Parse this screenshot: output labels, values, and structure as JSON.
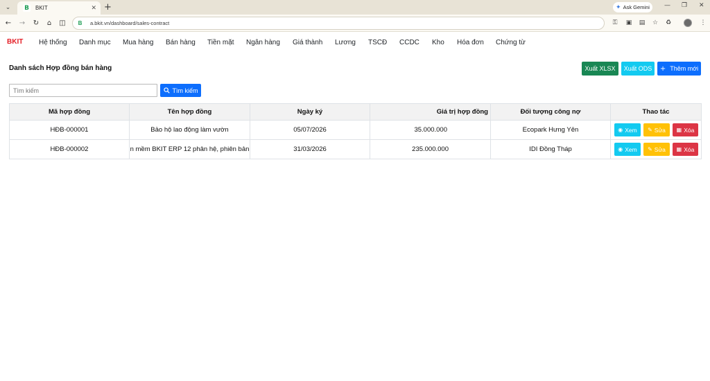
{
  "browser": {
    "tab_title": "BKIT",
    "tab_favicon": "B",
    "url": "a.bkit.vn/dashboard/sales-contract",
    "gemini_label": "Ask Gemini"
  },
  "app": {
    "brand": "BKIT",
    "brand_color": "#e41e26",
    "menu": [
      "Hệ thống",
      "Danh mục",
      "Mua hàng",
      "Bán hàng",
      "Tiền mặt",
      "Ngân hàng",
      "Giá thành",
      "Lương",
      "TSCĐ",
      "CCDC",
      "Kho",
      "Hóa đơn",
      "Chứng từ"
    ]
  },
  "page": {
    "title": "Danh sách Hợp đồng bán hàng",
    "export_xlsx": "Xuất XLSX",
    "export_ods": "Xuất ODS",
    "add_new": "Thêm mới"
  },
  "search": {
    "placeholder": "Tìm kiếm",
    "value": "",
    "button": "Tìm kiếm"
  },
  "table": {
    "headers": [
      "Mã hợp đồng",
      "Tên hợp đồng",
      "Ngày ký",
      "Giá trị hợp đồng",
      "Đối tượng công nợ",
      "Thao tác"
    ],
    "rows": [
      {
        "code": "HĐB-000001",
        "name": "Bảo hộ lao động làm vườn",
        "date": "05/07/2026",
        "value": "35.000.000",
        "party": "Ecopark Hưng Yên"
      },
      {
        "code": "HĐB-000002",
        "name": "n mềm BKIT ERP 12 phân hệ, phiên bản",
        "date": "31/03/2026",
        "value": "235.000.000",
        "party": "IDI Đồng Tháp"
      }
    ],
    "actions": {
      "view": "Xem",
      "edit": "Sửa",
      "delete": "Xóa"
    }
  },
  "colors": {
    "success": "#198754",
    "info": "#13caf0",
    "primary": "#0d6efd",
    "warning": "#ffc107",
    "danger": "#dc3545"
  }
}
